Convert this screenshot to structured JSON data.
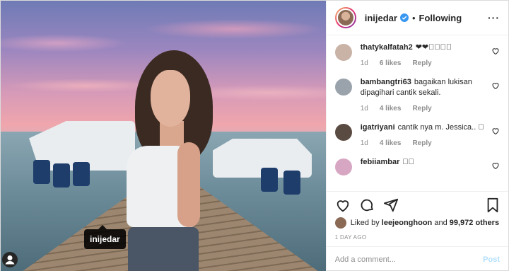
{
  "post": {
    "photo_tag": {
      "username": "inijedar"
    }
  },
  "header": {
    "username": "inijedar",
    "follow_label": "Following",
    "separator": "•"
  },
  "comments": [
    {
      "username": "thatykalfatah2",
      "text": "❤❤󾓩󾓩󾓩󾓩",
      "age": "1d",
      "likes": "6 likes",
      "reply": "Reply",
      "avatar_color": "#c9b2a6"
    },
    {
      "username": "bambangtri63",
      "text": "bagaikan lukisan dipagihari cantik sekali.",
      "age": "1d",
      "likes": "4 likes",
      "reply": "Reply",
      "avatar_color": "#9aa3ab"
    },
    {
      "username": "igatriyani",
      "text": "cantik nya m. Jessica.. 󾓩",
      "age": "1d",
      "likes": "4 likes",
      "reply": "Reply",
      "avatar_color": "#5a4b42"
    },
    {
      "username": "febiiambar",
      "text": "󾓩󾓩",
      "age": "",
      "likes": "",
      "reply": "",
      "avatar_color": "#d7a6c2"
    }
  ],
  "likes": {
    "prefix": "Liked by",
    "user": "leejeonghoon",
    "connector": "and",
    "others": "99,972 others"
  },
  "timestamp": "1 DAY AGO",
  "add_comment": {
    "placeholder": "Add a comment...",
    "post_label": "Post"
  },
  "colors": {
    "verified": "#3897f0",
    "post_disabled": "#b2dffc",
    "meta": "#8e8e8e"
  }
}
